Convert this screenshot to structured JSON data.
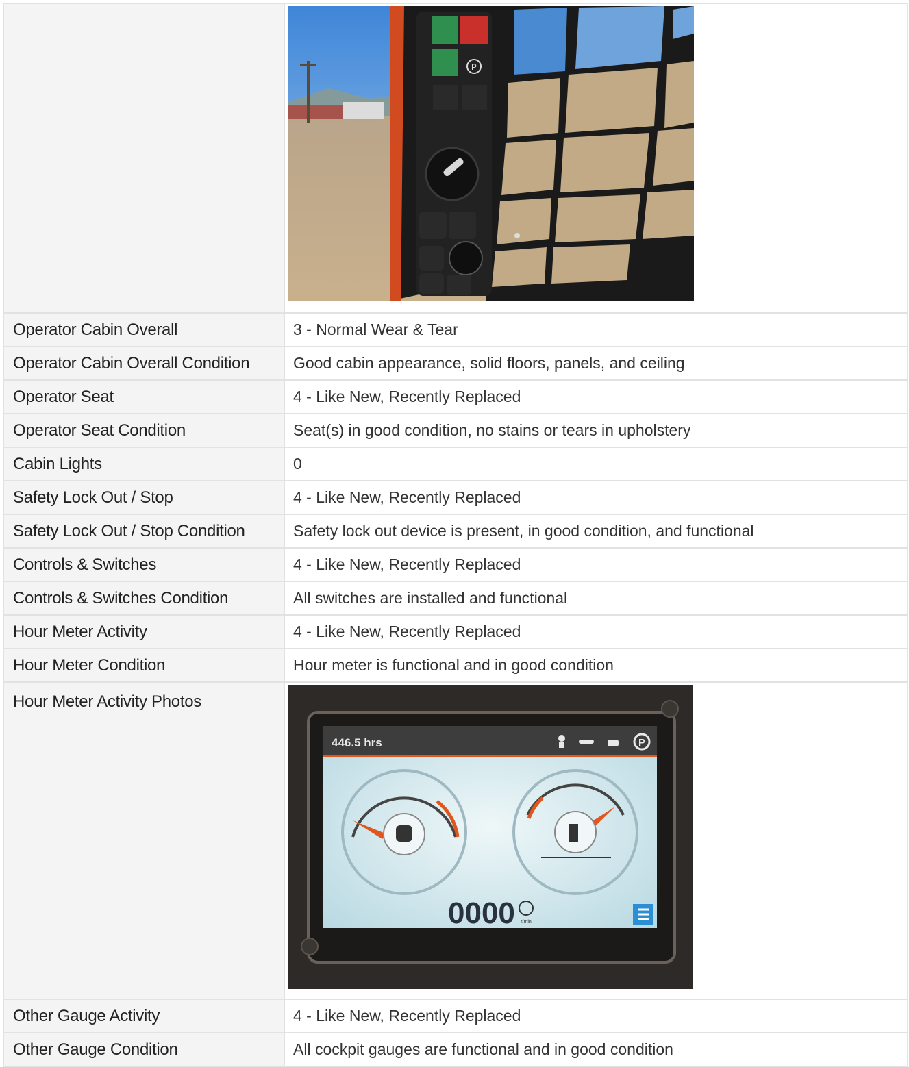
{
  "rows": [
    {
      "label": "",
      "value": "",
      "photo": "cabin-controls-photo"
    },
    {
      "label": "Operator Cabin Overall",
      "value": "3 - Normal Wear & Tear"
    },
    {
      "label": "Operator Cabin Overall Condition",
      "value": "Good cabin appearance, solid floors, panels, and ceiling"
    },
    {
      "label": "Operator Seat",
      "value": "4 - Like New, Recently Replaced"
    },
    {
      "label": "Operator Seat Condition",
      "value": "Seat(s) in good condition, no stains or tears in upholstery"
    },
    {
      "label": "Cabin Lights",
      "value": "0"
    },
    {
      "label": "Safety Lock Out / Stop",
      "value": "4 - Like New, Recently Replaced"
    },
    {
      "label": "Safety Lock Out / Stop Condition",
      "value": "Safety lock out device is present, in good condition, and functional"
    },
    {
      "label": "Controls & Switches",
      "value": "4 - Like New, Recently Replaced"
    },
    {
      "label": "Controls & Switches Condition",
      "value": "All switches are installed and functional"
    },
    {
      "label": "Hour Meter Activity",
      "value": "4 - Like New, Recently Replaced"
    },
    {
      "label": "Hour Meter Condition",
      "value": "Hour meter is functional and in good condition"
    },
    {
      "label": "Hour Meter Activity Photos",
      "value": "",
      "photo": "hour-meter-photo"
    },
    {
      "label": "Other Gauge Activity",
      "value": "4 - Like New, Recently Replaced"
    },
    {
      "label": "Other Gauge Condition",
      "value": "All cockpit gauges are functional and in good condition"
    }
  ],
  "hour_meter_display": {
    "hours": "446.5 hrs",
    "rpm": "0000",
    "rpm_unit": "r/min"
  },
  "colors": {
    "panel_green": "#2f8f4e",
    "panel_red": "#c9302c",
    "gauge_orange": "#e0561c",
    "menu_blue": "#2b8fd6"
  }
}
